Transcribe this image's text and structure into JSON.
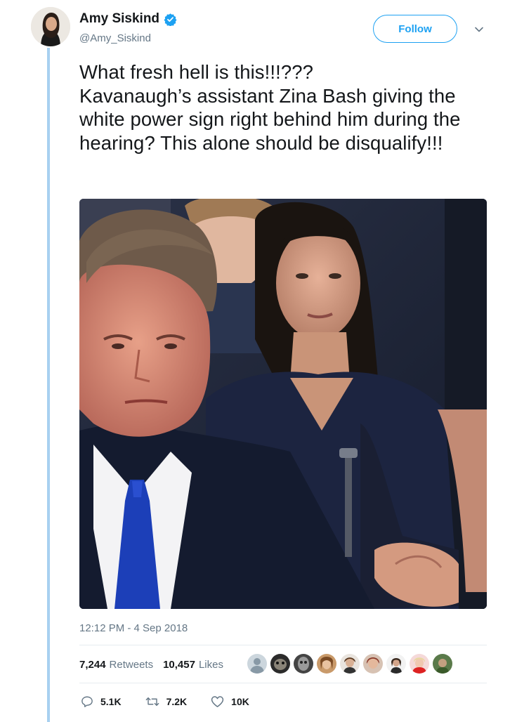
{
  "tweet": {
    "author": {
      "display_name": "Amy Siskind",
      "handle": "@Amy_Siskind",
      "verified_icon": "verified-badge-icon"
    },
    "follow_label": "Follow",
    "text": "What fresh hell is this!!!???\nKavanaugh’s assistant Zina Bash giving the white power sign right behind him during the hearing?  This alone should be disqualify!!!",
    "timestamp": "12:12 PM - 4 Sep 2018",
    "stats": {
      "retweets_count": "7,244",
      "retweets_label": "Retweets",
      "likes_count": "10,457",
      "likes_label": "Likes"
    },
    "liker_avatar_count": 9,
    "actions": {
      "replies": "5.1K",
      "retweets": "7.2K",
      "likes": "10K"
    }
  },
  "colors": {
    "brand_blue": "#1da1f2",
    "thread_line": "#a8d0f0",
    "secondary_text": "#657786",
    "divider": "#e6ecf0"
  }
}
